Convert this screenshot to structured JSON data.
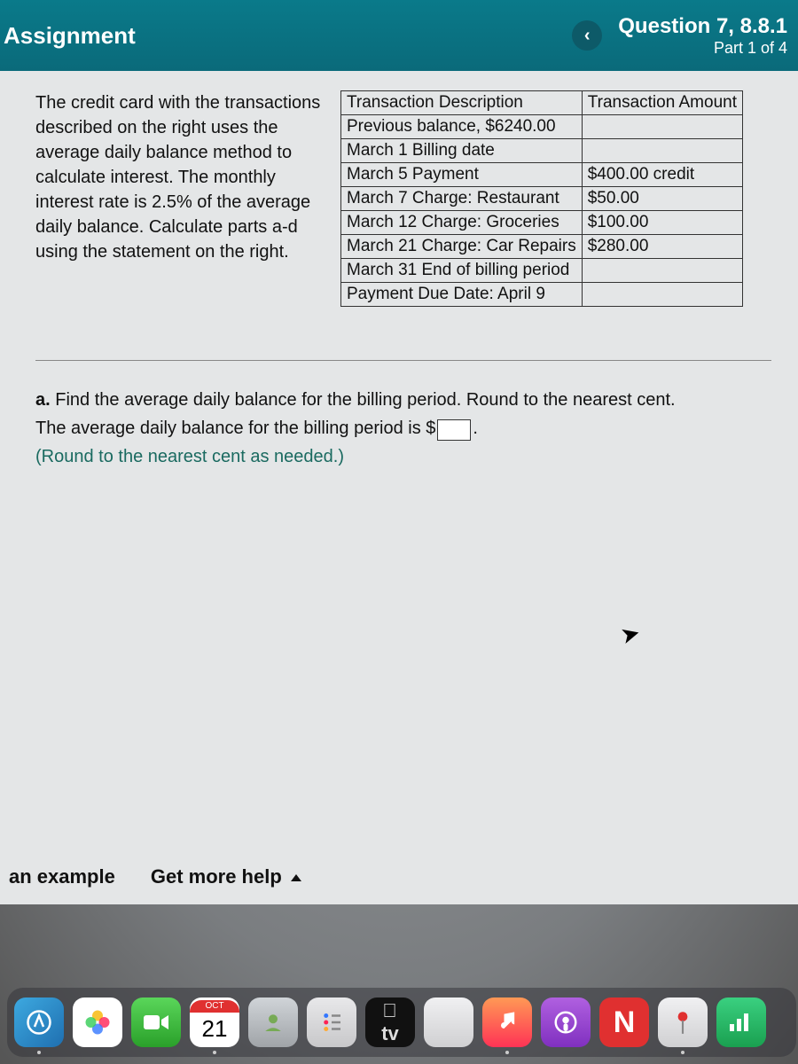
{
  "header": {
    "title": "Assignment",
    "nav_prev": "‹",
    "question": "Question 7, 8.8.1",
    "part": "Part 1 of 4"
  },
  "problem": {
    "text": "The credit card with the transactions described on the right uses the average daily balance method to calculate interest.  The monthly interest rate is 2.5% of the average daily balance.  Calculate parts a-d using the statement on the right."
  },
  "table": {
    "col1": "Transaction Description",
    "col2": "Transaction Amount",
    "rows": [
      {
        "desc": "Previous balance, $6240.00",
        "amt": ""
      },
      {
        "desc": "March 1 Billing date",
        "amt": ""
      },
      {
        "desc": "March 5 Payment",
        "amt": "$400.00 credit"
      },
      {
        "desc": "March 7 Charge: Restaurant",
        "amt": "$50.00"
      },
      {
        "desc": "March 12 Charge: Groceries",
        "amt": "$100.00"
      },
      {
        "desc": "March 21 Charge: Car Repairs",
        "amt": "$280.00"
      },
      {
        "desc": "March 31 End of billing period",
        "amt": ""
      },
      {
        "desc": "Payment Due Date: April 9",
        "amt": ""
      }
    ]
  },
  "partA": {
    "label": "a.",
    "prompt": " Find the average daily balance for the billing period.  Round to the nearest cent.",
    "line2a": "The average daily balance for the billing period is $",
    "line2b": ".",
    "hint": "(Round to the nearest cent as needed.)"
  },
  "footer": {
    "example": "an example",
    "help": "Get more help"
  },
  "dock": {
    "cal_month": "OCT",
    "cal_day": "21",
    "tv": "tv"
  }
}
